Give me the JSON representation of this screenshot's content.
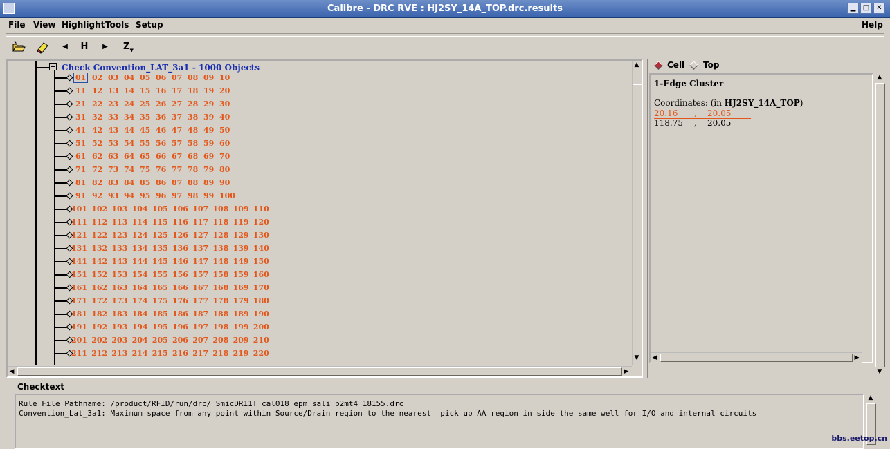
{
  "window": {
    "title": "Calibre - DRC RVE : HJ2SY_14A_TOP.drc.results",
    "controls": [
      "minimize",
      "maximize",
      "close"
    ]
  },
  "menubar": {
    "items": [
      {
        "label": "File"
      },
      {
        "label": "View"
      },
      {
        "label": "Highlight"
      },
      {
        "label": "Tools"
      },
      {
        "label": "Setup"
      }
    ],
    "help": "Help"
  },
  "toolbar": {
    "items": [
      {
        "name": "open-folder-icon"
      },
      {
        "name": "eraser-icon"
      },
      {
        "name": "prev-arrow-icon",
        "glyph": "◀"
      },
      {
        "name": "highlight-button",
        "label": "H"
      },
      {
        "name": "next-arrow-icon",
        "glyph": "▶"
      },
      {
        "name": "zoom-button",
        "label": "Z"
      }
    ]
  },
  "tree": {
    "check_label": "Check Convention_LAT_3a1 - 1000 Objects",
    "rows": [
      [
        "01",
        "02",
        "03",
        "04",
        "05",
        "06",
        "07",
        "08",
        "09",
        "10"
      ],
      [
        "11",
        "12",
        "13",
        "14",
        "15",
        "16",
        "17",
        "18",
        "19",
        "20"
      ],
      [
        "21",
        "22",
        "23",
        "24",
        "25",
        "26",
        "27",
        "28",
        "29",
        "30"
      ],
      [
        "31",
        "32",
        "33",
        "34",
        "35",
        "36",
        "37",
        "38",
        "39",
        "40"
      ],
      [
        "41",
        "42",
        "43",
        "44",
        "45",
        "46",
        "47",
        "48",
        "49",
        "50"
      ],
      [
        "51",
        "52",
        "53",
        "54",
        "55",
        "56",
        "57",
        "58",
        "59",
        "60"
      ],
      [
        "61",
        "62",
        "63",
        "64",
        "65",
        "66",
        "67",
        "68",
        "69",
        "70"
      ],
      [
        "71",
        "72",
        "73",
        "74",
        "75",
        "76",
        "77",
        "78",
        "79",
        "80"
      ],
      [
        "81",
        "82",
        "83",
        "84",
        "85",
        "86",
        "87",
        "88",
        "89",
        "90"
      ],
      [
        "91",
        "92",
        "93",
        "94",
        "95",
        "96",
        "97",
        "98",
        "99",
        "100"
      ],
      [
        "101",
        "102",
        "103",
        "104",
        "105",
        "106",
        "107",
        "108",
        "109",
        "110"
      ],
      [
        "111",
        "112",
        "113",
        "114",
        "115",
        "116",
        "117",
        "118",
        "119",
        "120"
      ],
      [
        "121",
        "122",
        "123",
        "124",
        "125",
        "126",
        "127",
        "128",
        "129",
        "130"
      ],
      [
        "131",
        "132",
        "133",
        "134",
        "135",
        "136",
        "137",
        "138",
        "139",
        "140"
      ],
      [
        "141",
        "142",
        "143",
        "144",
        "145",
        "146",
        "147",
        "148",
        "149",
        "150"
      ],
      [
        "151",
        "152",
        "153",
        "154",
        "155",
        "156",
        "157",
        "158",
        "159",
        "160"
      ],
      [
        "161",
        "162",
        "163",
        "164",
        "165",
        "166",
        "167",
        "168",
        "169",
        "170"
      ],
      [
        "171",
        "172",
        "173",
        "174",
        "175",
        "176",
        "177",
        "178",
        "179",
        "180"
      ],
      [
        "181",
        "182",
        "183",
        "184",
        "185",
        "186",
        "187",
        "188",
        "189",
        "190"
      ],
      [
        "191",
        "192",
        "193",
        "194",
        "195",
        "196",
        "197",
        "198",
        "199",
        "200"
      ],
      [
        "201",
        "202",
        "203",
        "204",
        "205",
        "206",
        "207",
        "208",
        "209",
        "210"
      ],
      [
        "211",
        "212",
        "213",
        "214",
        "215",
        "216",
        "217",
        "218",
        "219",
        "220"
      ]
    ],
    "selected": "01",
    "number_color": "#e2581c",
    "header_color": "#1a2fb0"
  },
  "right_panel": {
    "radio_cell": "Cell",
    "radio_top": "Top",
    "selected_radio": "Cell",
    "cluster_title": "1-Edge Cluster",
    "coords_prefix": "Coordinates: (in ",
    "coords_cell": "HJ2SY_14A_TOP",
    "coords_suffix": ")",
    "coord_rows": [
      {
        "x": "20.16",
        "sep": ",",
        "y": "20.05",
        "highlighted": true
      },
      {
        "x": "118.75",
        "sep": ",",
        "y": "20.05",
        "highlighted": false
      }
    ],
    "highlight_color": "#e2581c"
  },
  "checktext": {
    "label": "Checktext",
    "lines": [
      "Rule File Pathname: /product/RFID/run/drc/_SmicDR11T_cal018_epm_sali_p2mt4_18155.drc_",
      "Convention_Lat_3a1: Maximum space from any point within Source/Drain region to the nearest  pick up AA region in side the same well for I/O and internal circuits"
    ]
  },
  "watermark": "bbs.eetop.cn"
}
